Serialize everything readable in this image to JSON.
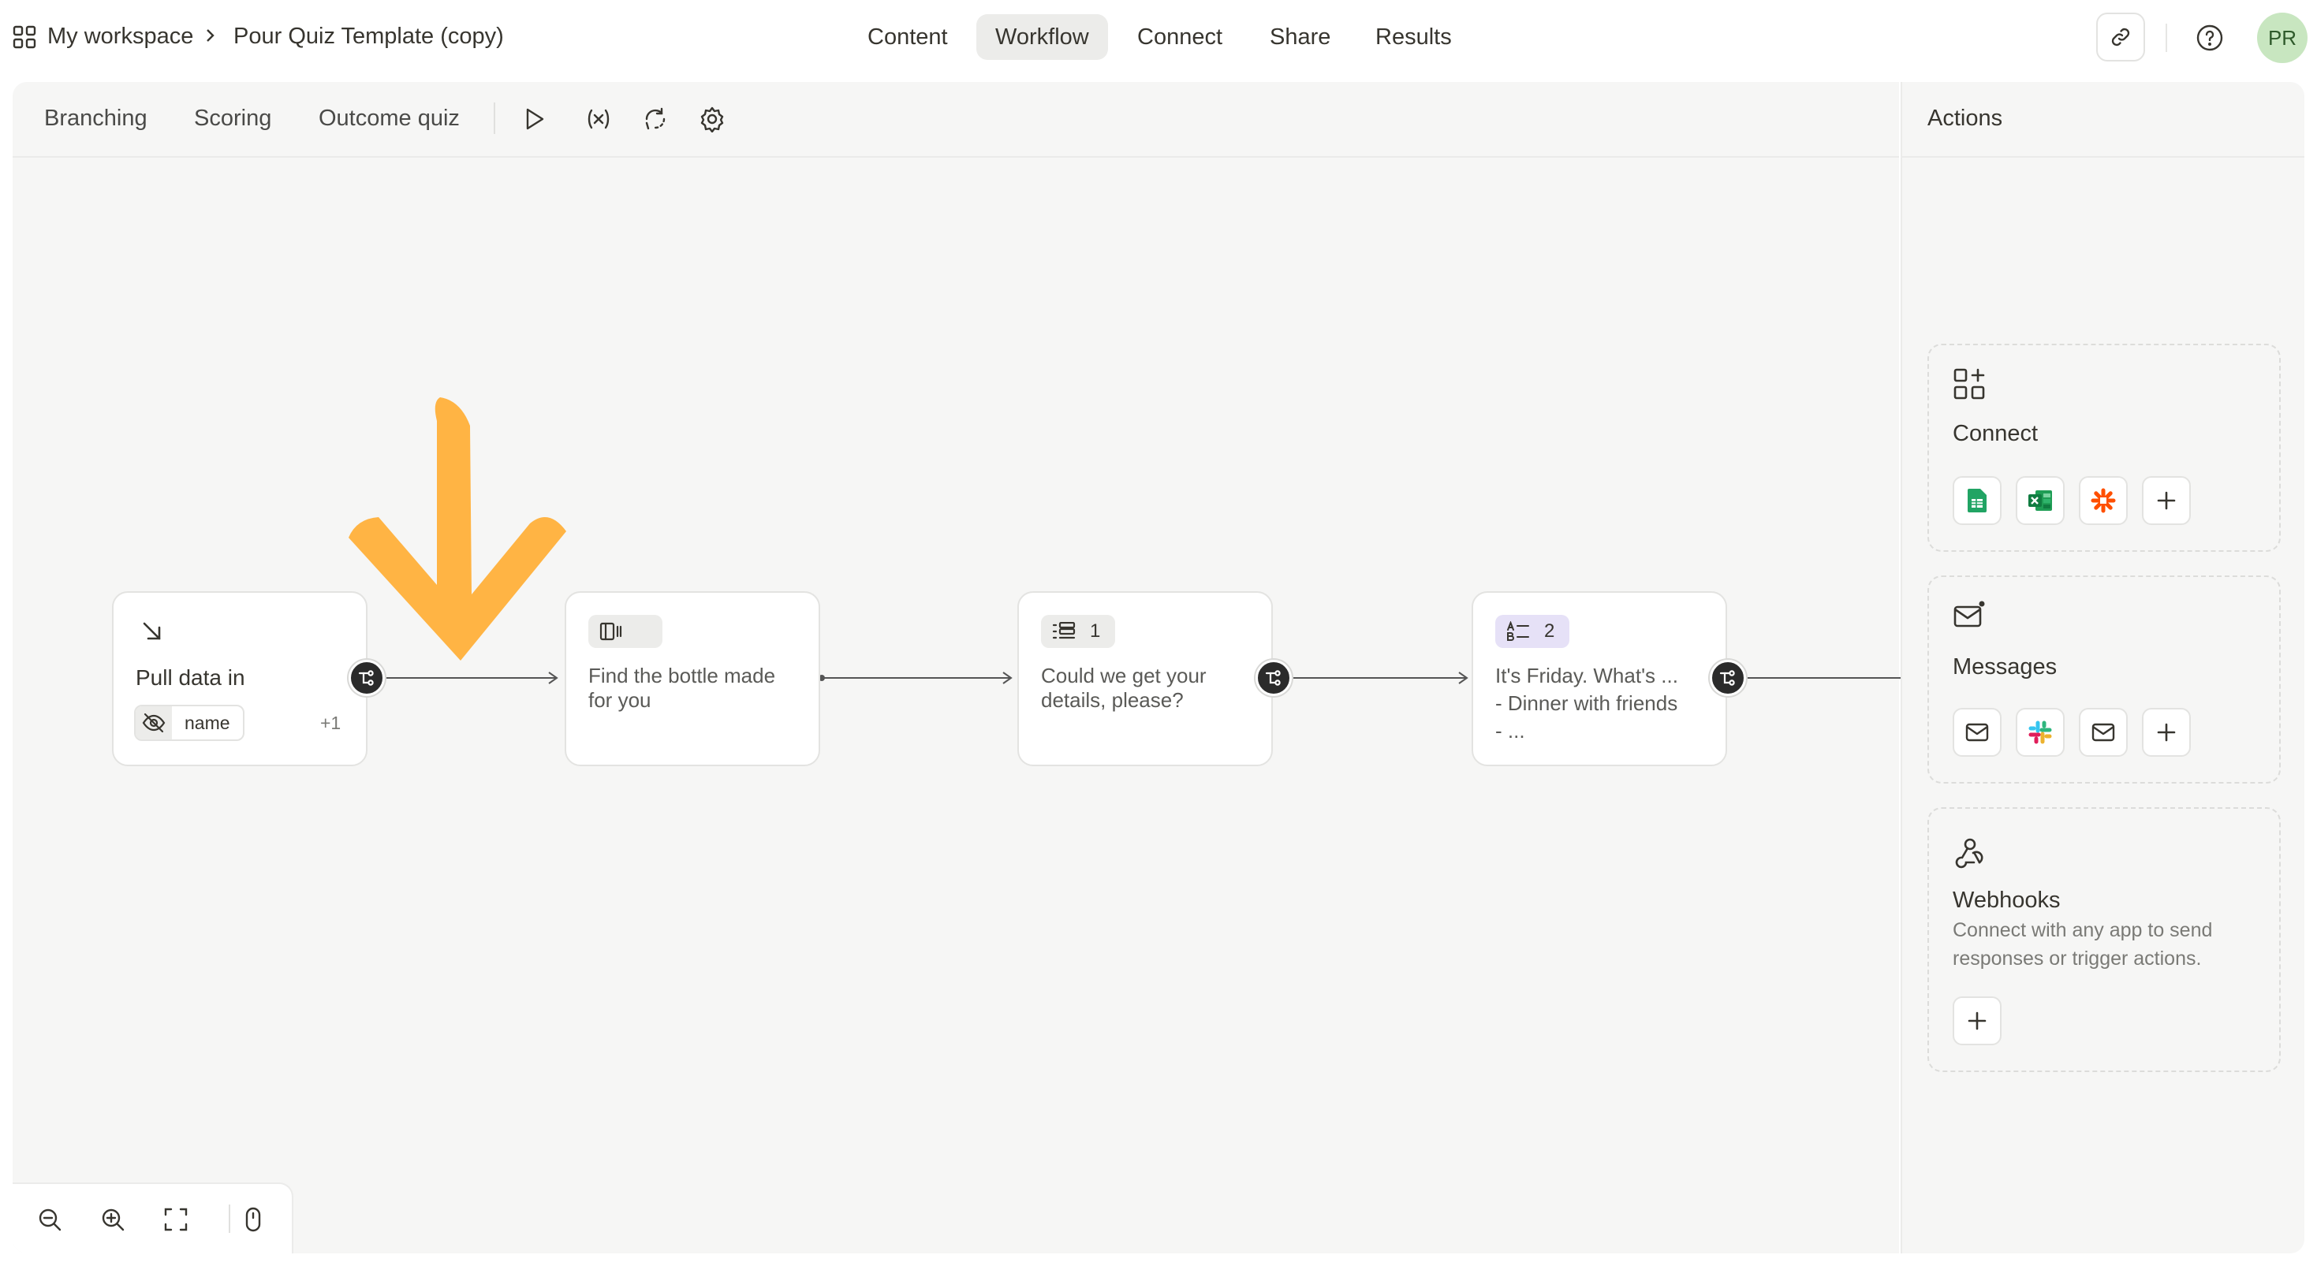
{
  "breadcrumb": {
    "workspace": "My workspace",
    "title": "Pour Quiz Template (copy)"
  },
  "nav": {
    "tabs": [
      {
        "label": "Content"
      },
      {
        "label": "Workflow",
        "active": true
      },
      {
        "label": "Connect"
      },
      {
        "label": "Share"
      },
      {
        "label": "Results"
      }
    ]
  },
  "user": {
    "initials": "PR"
  },
  "subnav": {
    "tabs": [
      "Branching",
      "Scoring",
      "Outcome quiz"
    ]
  },
  "nodes": {
    "pull": {
      "title": "Pull data in",
      "tag": "name",
      "more": "+1"
    },
    "statement": {
      "text_line1": "Find the bottle made",
      "text_line2": "for you"
    },
    "contact": {
      "number": "1",
      "text_line1": "Could we get your",
      "text_line2": "details, please?"
    },
    "ranking": {
      "number": "2",
      "text_line1": "It's Friday. What's ...",
      "text_line2": "- Dinner with friends",
      "text_line3": "- ..."
    }
  },
  "actions": {
    "title": "Actions",
    "connect": {
      "title": "Connect",
      "icons": [
        "google-sheets-icon",
        "excel-icon",
        "zapier-icon",
        "plus-icon"
      ]
    },
    "messages": {
      "title": "Messages",
      "icons": [
        "mail-icon",
        "slack-icon",
        "mail-icon",
        "plus-icon"
      ]
    },
    "webhooks": {
      "title": "Webhooks",
      "desc_line1": "Connect with any app to send",
      "desc_line2": "responses or trigger actions."
    }
  },
  "colors": {
    "annotation_arrow": "#ffb444",
    "connector": "#2b2b2b",
    "canvas": "#f6f6f5",
    "chip_purple": "#e6e1f7"
  }
}
